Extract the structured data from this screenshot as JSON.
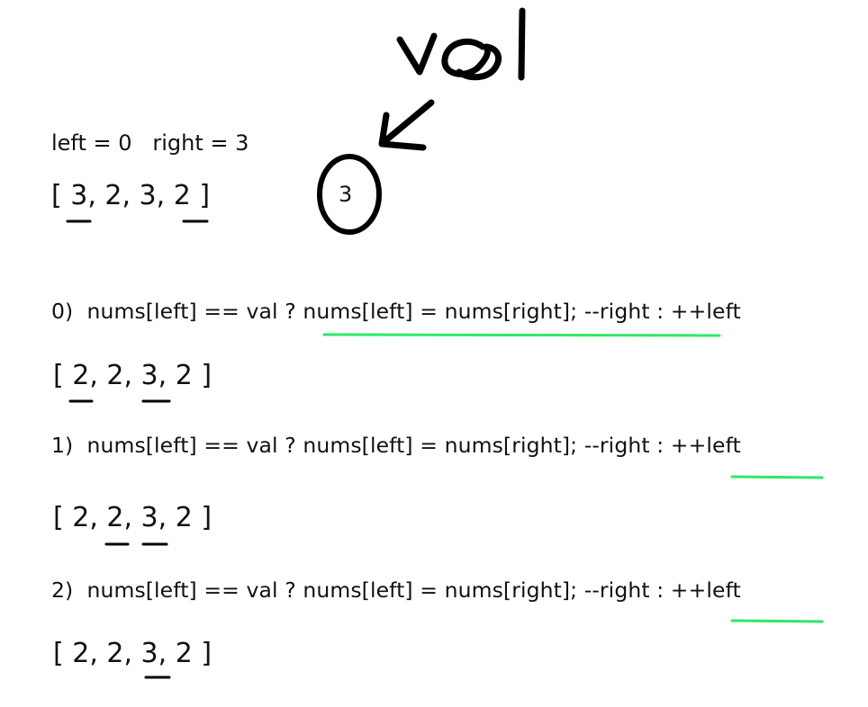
{
  "annotation": {
    "val_label": "val",
    "val_value": "3"
  },
  "pointers": "left = 0   right = 3",
  "initial_array": "[ 3, 2, 3, 2 ]",
  "steps": [
    {
      "code": "0)  nums[left] == val ? nums[left] = nums[right]; --right : ++left",
      "array": "[ 2, 2, 3, 2 ]",
      "highlighted_branch": "nums[left] = nums[right]; --right"
    },
    {
      "code": "1)  nums[left] == val ? nums[left] = nums[right]; --right : ++left",
      "array": "[ 2, 2, 3, 2 ]",
      "highlighted_branch": "++left"
    },
    {
      "code": "2)  nums[left] == val ? nums[left] = nums[right]; --right : ++left",
      "array": "[ 2, 2, 3, 2 ]",
      "highlighted_branch": "++left"
    }
  ],
  "colors": {
    "ink": "#000000",
    "highlight": "#2ee86a"
  }
}
